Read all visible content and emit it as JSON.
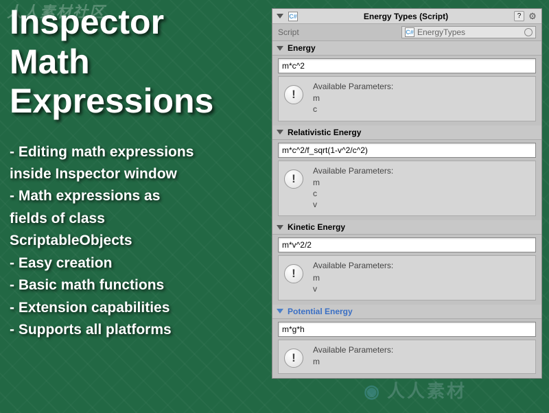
{
  "left": {
    "title_line1": "Inspector",
    "title_line2": "Math",
    "title_line3": "Expressions",
    "features": [
      "- Editing math expressions",
      "  inside Inspector window",
      "- Math expressions  as",
      "   fields of class",
      "   ScriptableObjects",
      "- Easy creation",
      "- Basic math functions",
      "- Extension capabilities",
      "- Supports all platforms"
    ]
  },
  "inspector": {
    "header_title": "Energy Types (Script)",
    "script_label": "Script",
    "script_value": "EnergyTypes",
    "params_title": "Available Parameters:",
    "sections": [
      {
        "title": "Energy",
        "expression": "m*c^2",
        "params": [
          "m",
          "c"
        ],
        "active": false
      },
      {
        "title": "Relativistic Energy",
        "expression": "m*c^2/f_sqrt(1-v^2/c^2)",
        "params": [
          "m",
          "c",
          "v"
        ],
        "active": false
      },
      {
        "title": "Kinetic Energy",
        "expression": "m*v^2/2",
        "params": [
          "m",
          "v"
        ],
        "active": false
      },
      {
        "title": "Potential Energy",
        "expression": "m*g*h",
        "params": [
          "m"
        ],
        "active": true
      }
    ]
  },
  "watermarks": {
    "top_left": "人人素材社区",
    "bottom_right": "人人素材"
  }
}
